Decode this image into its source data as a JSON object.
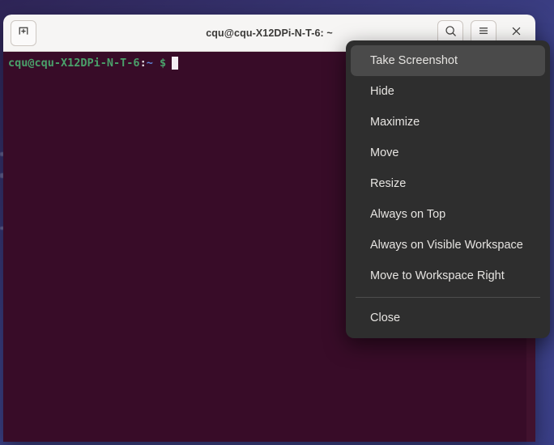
{
  "desktop": {
    "wallpaper_color": "#3b3f85"
  },
  "terminal": {
    "title": "cqu@cqu-X12DPi-N-T-6: ~",
    "background_color": "#380c28",
    "titlebar": {
      "new_tab_icon": "new-tab-plus-icon",
      "search_icon": "search-icon",
      "menu_icon": "hamburger-menu-icon",
      "close_icon": "close-x-icon"
    },
    "prompt": {
      "user_host": "cqu@cqu-X12DPi-N-T-6",
      "colon": ":",
      "path": "~",
      "dollar": "$",
      "user_host_color": "#4aa06a",
      "path_color": "#5f83d8"
    }
  },
  "window_menu": {
    "background_color": "#2e2e2e",
    "highlight_color": "#4a4a4a",
    "items": [
      {
        "label": "Take Screenshot",
        "selected": true
      },
      {
        "label": "Hide",
        "selected": false
      },
      {
        "label": "Maximize",
        "selected": false
      },
      {
        "label": "Move",
        "selected": false
      },
      {
        "label": "Resize",
        "selected": false
      },
      {
        "label": "Always on Top",
        "selected": false
      },
      {
        "label": "Always on Visible Workspace",
        "selected": false
      },
      {
        "label": "Move to Workspace Right",
        "selected": false
      },
      {
        "label": "Close",
        "selected": false
      }
    ]
  }
}
